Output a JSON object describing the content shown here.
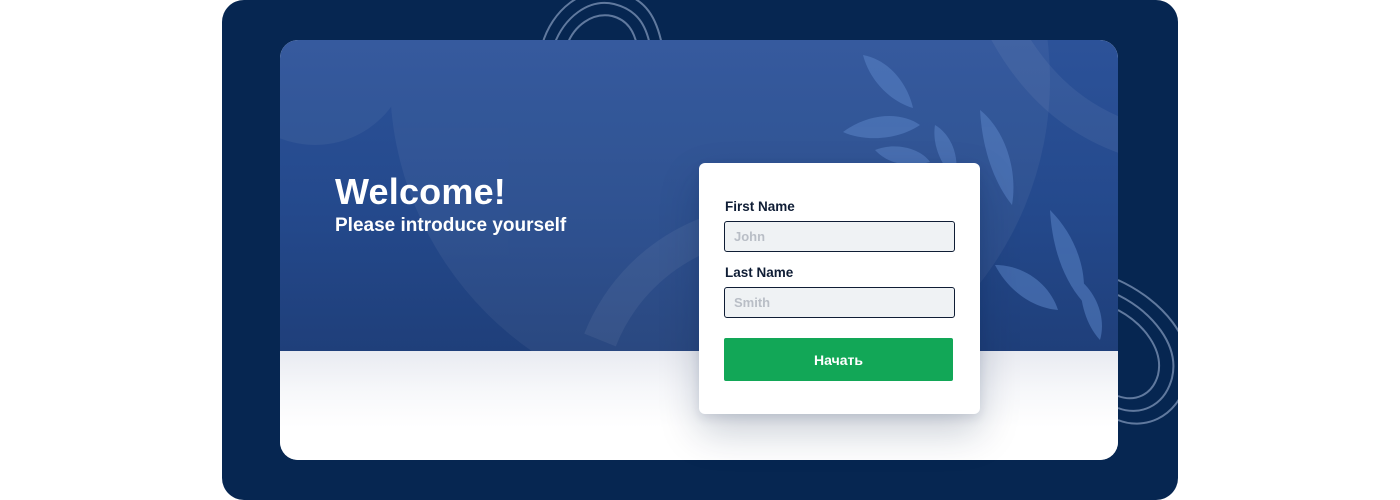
{
  "hero": {
    "title": "Welcome!",
    "subtitle": "Please introduce yourself"
  },
  "form": {
    "first_name": {
      "label": "First Name",
      "placeholder": "John",
      "value": ""
    },
    "last_name": {
      "label": "Last Name",
      "placeholder": "Smith",
      "value": ""
    },
    "submit_label": "Начать"
  },
  "colors": {
    "frame_background": "#062651",
    "hero_background": "#2a5095",
    "button_background": "#12a757",
    "input_background": "#eff2f4",
    "text_dark": "#0f1d35"
  }
}
